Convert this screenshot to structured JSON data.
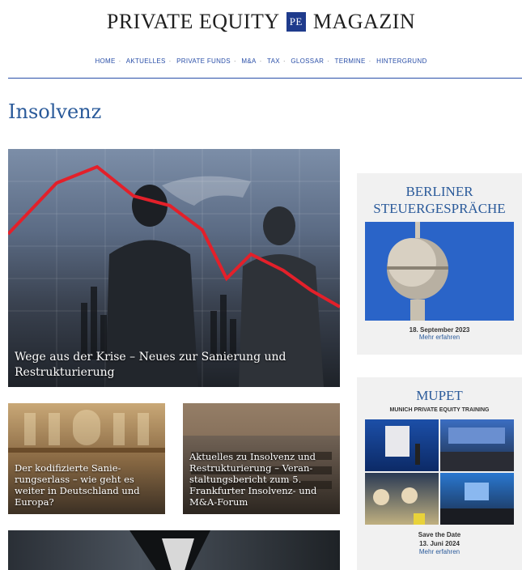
{
  "header": {
    "title_left": "PRIVATE EQUITY",
    "logo_text": "PE",
    "title_right": "MAGAZIN"
  },
  "nav": {
    "items": [
      {
        "label": "HOME"
      },
      {
        "label": "AKTUELLES"
      },
      {
        "label": "PRIVATE FUNDS"
      },
      {
        "label": "M&A"
      },
      {
        "label": "TAX"
      },
      {
        "label": "GLOSSAR"
      },
      {
        "label": "TERMINE"
      },
      {
        "label": "HINTERGRUND"
      }
    ]
  },
  "page": {
    "title": "Insolvenz"
  },
  "articles": {
    "hero": {
      "title": "Wege aus der Krise – Neues zur Sanierung und Restrukturierung"
    },
    "card_a": {
      "title": "Der kodifizierte Sanie-rungserlass – wie geht es weiter in Deutschland und Europa?"
    },
    "card_b": {
      "title": "Aktuelles zu Insolvenz und Restrukturierung – Veran-staltungsbericht zum 5. Frankfurter Insolvenz- und M&A-Forum"
    }
  },
  "sidebar": {
    "event1": {
      "title": "BERLINER STEUERGESPRÄCHE",
      "date": "18. September 2023",
      "link": "Mehr erfahren"
    },
    "event2": {
      "title": "MUPET",
      "subtitle": "MUNICH PRIVATE EQUITY TRAINING",
      "save": "Save the Date",
      "date": "13. Juni 2024",
      "link": "Mehr erfahren"
    }
  },
  "colors": {
    "accent": "#2a5a9a",
    "logo_bg": "#1f3b8c",
    "nav": "#2a4fa8",
    "chart_line": "#e3202a"
  }
}
